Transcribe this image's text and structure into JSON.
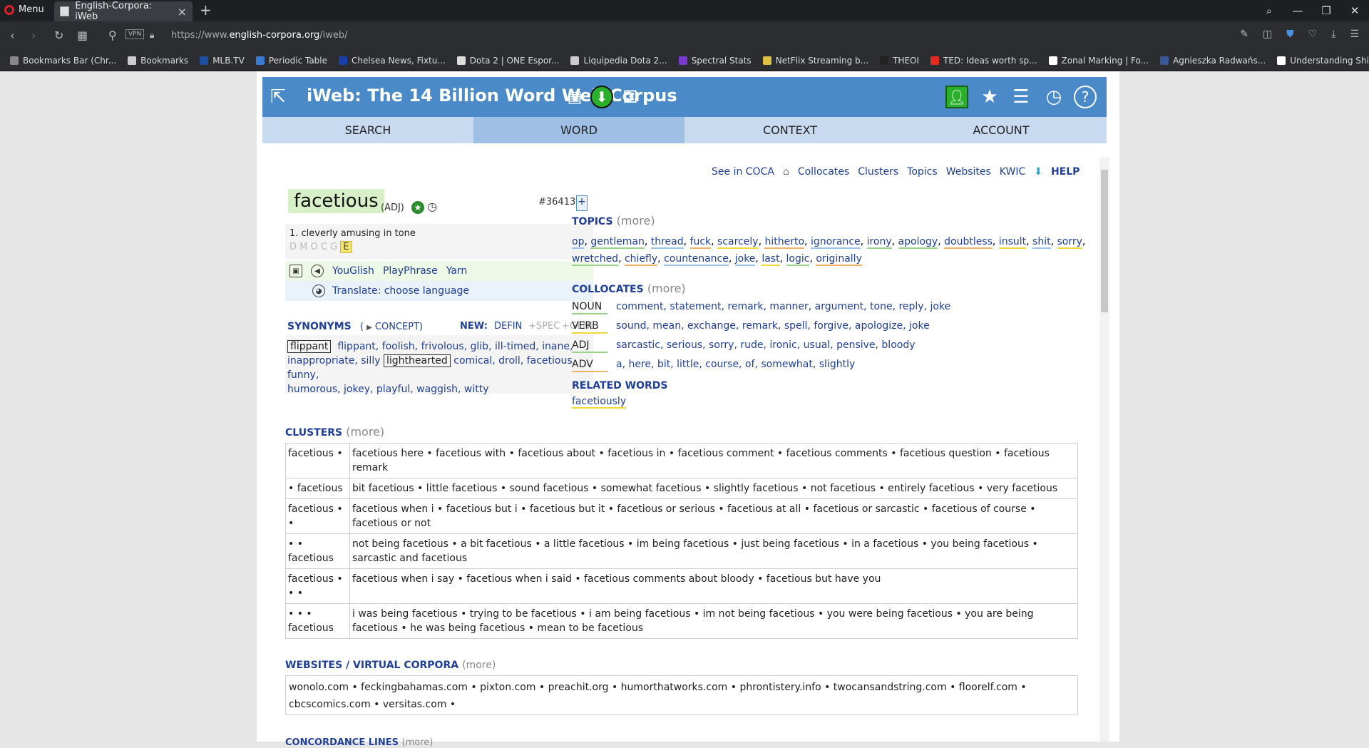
{
  "browser": {
    "menu_label": "Menu",
    "tab_title": "English-Corpora: iWeb",
    "url_prefix": "https://www.",
    "url_domain": "english-corpora.org",
    "url_path": "/iweb/",
    "vpn_label": "VPN",
    "bookmarks": [
      {
        "label": "Bookmarks Bar (Chr...",
        "color": "#888888"
      },
      {
        "label": "Bookmarks",
        "color": "#cccccc"
      },
      {
        "label": "MLB.TV",
        "color": "#1f4fa0"
      },
      {
        "label": "Periodic Table",
        "color": "#3a7bd5"
      },
      {
        "label": "Chelsea News, Fixtu...",
        "color": "#1a3fa8"
      },
      {
        "label": "Dota 2 | ONE Espor...",
        "color": "#dddddd"
      },
      {
        "label": "Liquipedia Dota 2...",
        "color": "#cccccc"
      },
      {
        "label": "Spectral Stats",
        "color": "#7a3ad0"
      },
      {
        "label": "NetFlix Streaming b...",
        "color": "#e0c040"
      },
      {
        "label": "THEOI",
        "color": "#222222"
      },
      {
        "label": "TED: Ideas worth sp...",
        "color": "#e62b1e"
      },
      {
        "label": "Zonal Marking | Fo...",
        "color": "#ffffff"
      },
      {
        "label": "Agnieszka Radwańs...",
        "color": "#3b5998"
      },
      {
        "label": "Understanding Shir...",
        "color": "#ffffff"
      }
    ]
  },
  "header": {
    "title": "iWeb: The 14 Billion Word Web Corpus",
    "tabs": [
      "SEARCH",
      "WORD",
      "CONTEXT",
      "ACCOUNT"
    ],
    "active_tab": "WORD",
    "accent": "#4a8ac9"
  },
  "toplinks": {
    "see_coca": "See in COCA",
    "collocates": "Collocates",
    "clusters": "Clusters",
    "topics": "Topics",
    "websites": "Websites",
    "kwic": "KWIC",
    "help": "HELP"
  },
  "word": {
    "headword": "facetious",
    "pos": "(ADJ)",
    "rank": "#36413",
    "rank_plus": "+",
    "definition": "1. cleverly amusing in tone",
    "dmocg": "D M O C G",
    "e_label": "E",
    "media_links": [
      "YouGlish",
      "PlayPhrase",
      "Yarn"
    ],
    "translate": "Translate: choose language"
  },
  "synonyms": {
    "title": "SYNONYMS",
    "concept": "CONCEPT)",
    "concept_open": "(",
    "new_label": "NEW:",
    "defin": "DEFIN",
    "spec": "+SPEC",
    "genl": "+GENL",
    "line1_boxed": "flippant",
    "line1": "flippant,  foolish,  frivolous,  glib,  ill-timed,  inane,",
    "line2": "inappropriate,  silly",
    "line2_boxed": "lighthearted",
    "line2b": "comical,  droll,  facetious,  funny,",
    "line3": "humorous,  jokey,  playful,  waggish,  witty"
  },
  "topics": {
    "title": "TOPICS",
    "more": "(more)",
    "words": [
      "op",
      "gentleman",
      "thread",
      "fuck",
      "scarcely",
      "hitherto",
      "ignorance",
      "irony",
      "apology",
      "doubtless",
      "insult",
      "shit",
      "sorry",
      "wretched",
      "chiefly",
      "countenance",
      "joke",
      "last",
      "logic",
      "originally"
    ]
  },
  "collocates": {
    "title": "COLLOCATES",
    "more": "(more)",
    "rows": [
      {
        "pos": "NOUN",
        "words": "comment, statement, remark, manner, argument, tone, reply, joke"
      },
      {
        "pos": "VERB",
        "words": "sound, mean, exchange, remark, spell, forgive, apologize, joke"
      },
      {
        "pos": "ADJ",
        "words": "sarcastic, serious, sorry, rude, ironic, usual, pensive, bloody"
      },
      {
        "pos": "ADV",
        "words": "a, here, bit, little, course, of, somewhat, slightly"
      }
    ]
  },
  "related": {
    "title": "RELATED WORDS",
    "word": "facetiously"
  },
  "clusters": {
    "title": "CLUSTERS",
    "more": "(more)",
    "rows": [
      {
        "key": "facetious •",
        "vals": "facetious here • facetious with • facetious about • facetious in • facetious comment • facetious comments • facetious question • facetious remark"
      },
      {
        "key": "• facetious",
        "vals": "bit facetious • little facetious • sound facetious • somewhat facetious • slightly facetious • not facetious • entirely facetious • very facetious"
      },
      {
        "key": "facetious • •",
        "vals": "facetious when i • facetious but i • facetious but it • facetious or serious • facetious at all • facetious or sarcastic • facetious of course • facetious or not"
      },
      {
        "key": "• • facetious",
        "vals": "not being facetious • a bit facetious • a little facetious • im being facetious • just being facetious • in a facetious • you being facetious • sarcastic and facetious"
      },
      {
        "key": "facetious • • •",
        "vals": "facetious when i say • facetious when i said • facetious comments about bloody • facetious but have you"
      },
      {
        "key": "• • • facetious",
        "vals": "i was being facetious • trying to be facetious • i am being facetious • im not being facetious • you were being facetious • you are being facetious • he was being facetious • mean to be facetious"
      }
    ]
  },
  "websites": {
    "title": "WEBSITES / VIRTUAL CORPORA",
    "more": "(more)",
    "list": "wonolo.com • feckingbahamas.com • pixton.com • preachit.org • humorthatworks.com • phrontistery.info • twocansandstring.com • floorelf.com • cbcscomics.com • versitas.com •"
  },
  "concordance": {
    "title": "CONCORDANCE LINES",
    "more": "(more)"
  }
}
